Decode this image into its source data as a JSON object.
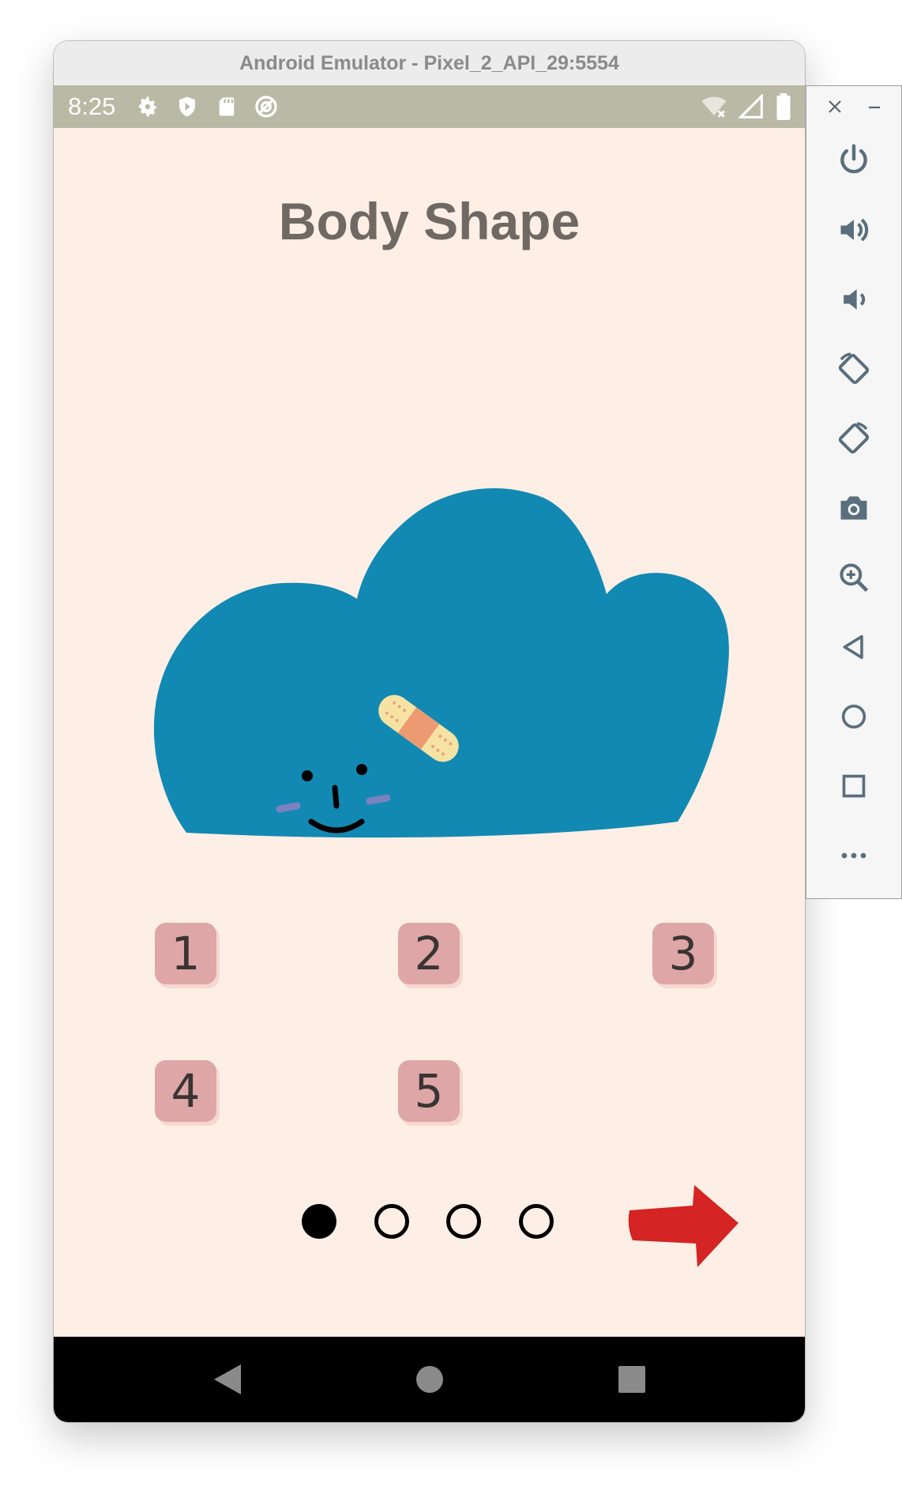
{
  "window": {
    "title": "Android Emulator - Pixel_2_API_29:5554"
  },
  "status_bar": {
    "time": "8:25"
  },
  "app": {
    "heading": "Body Shape",
    "options": [
      "1",
      "2",
      "3",
      "4",
      "5"
    ],
    "pager": {
      "current": 1,
      "total": 4
    }
  },
  "colors": {
    "background": "#fdefe5",
    "cloud": "#1289b3",
    "button": "#dea6a6",
    "arrow": "#d42424",
    "status_bar": "#b9b9a6"
  },
  "sidebar_tools": [
    "close-icon",
    "minimize-icon",
    "power-icon",
    "volume-up-icon",
    "volume-down-icon",
    "rotate-left-icon",
    "rotate-right-icon",
    "camera-icon",
    "zoom-icon",
    "back-icon",
    "home-icon",
    "overview-icon",
    "more-icon"
  ]
}
